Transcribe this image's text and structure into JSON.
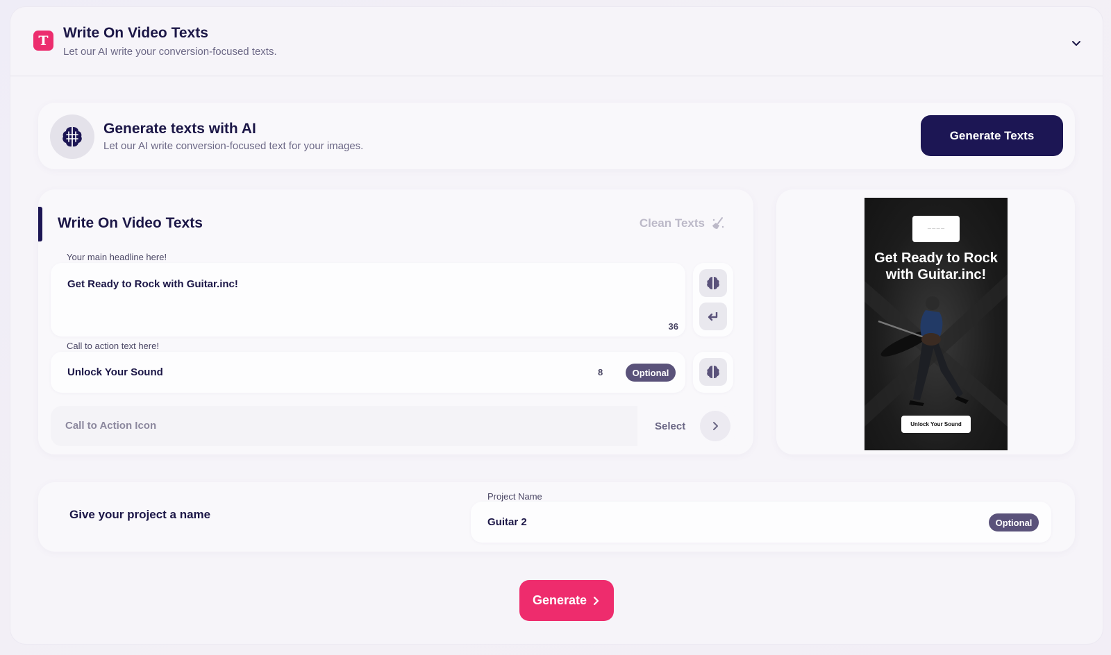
{
  "header": {
    "logo_letter": "T",
    "title": "Write On Video Texts",
    "subtitle": "Let our AI write your conversion-focused texts."
  },
  "ai_banner": {
    "title": "Generate texts with AI",
    "subtitle": "Let our AI write conversion-focused text for your images.",
    "button_label": "Generate Texts"
  },
  "texts": {
    "title": "Write On Video Texts",
    "clean_label": "Clean Texts",
    "headline": {
      "label": "Your main headline here!",
      "value": "Get Ready to Rock with Guitar.inc!",
      "count": "36"
    },
    "cta": {
      "label": "Call to action text here!",
      "value": "Unlock Your Sound",
      "count": "8",
      "badge": "Optional"
    },
    "cta_icon": {
      "label": "Call to Action Icon",
      "select_label": "Select"
    }
  },
  "preview": {
    "headline": "Get Ready to Rock with Guitar.inc!",
    "cta": "Unlock Your Sound"
  },
  "project": {
    "title": "Give your project a name",
    "field_label": "Project Name",
    "value": "Guitar 2",
    "badge": "Optional"
  },
  "generate_label": "Generate",
  "colors": {
    "accent_pink": "#ee2c6d",
    "navy": "#1c1654",
    "badge": "#5a527a"
  }
}
